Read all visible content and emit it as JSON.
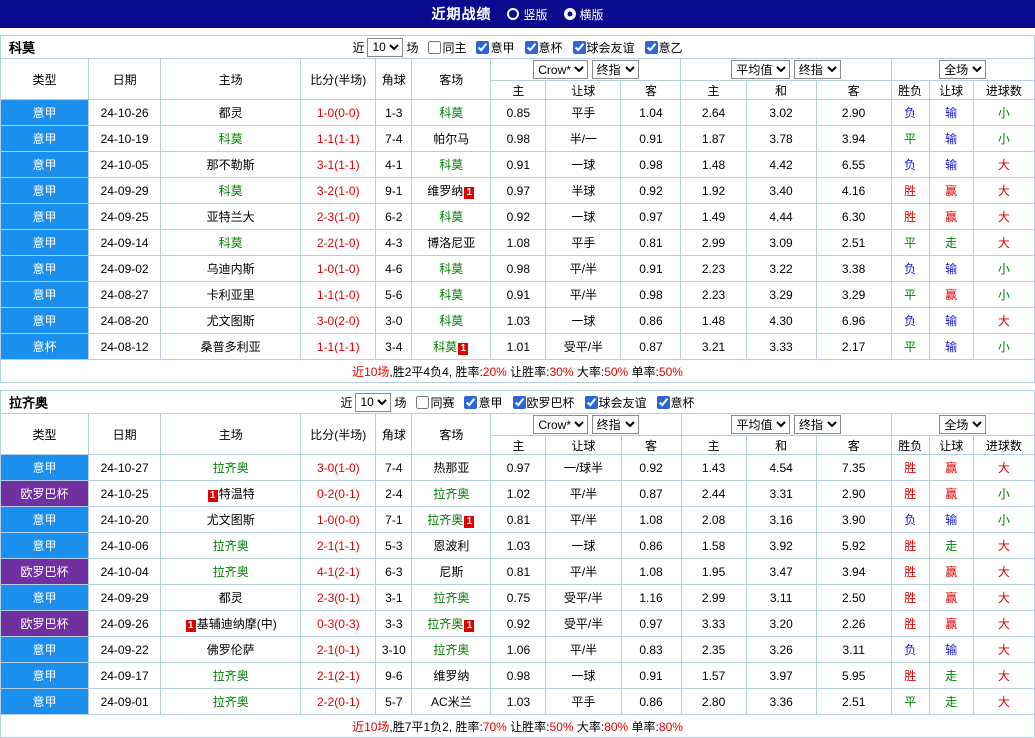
{
  "topbar": {
    "title": "近期战绩",
    "radios": [
      {
        "label": "竖版",
        "checked": false
      },
      {
        "label": "横版",
        "checked": true
      }
    ]
  },
  "colors": {
    "topbar_navy": "#0a0a8e",
    "league_blue": "#1a8fee",
    "league_purple": "#7030a0",
    "win_red": "#e10000",
    "draw_green": "#008000",
    "lose_blue": "#1515d8",
    "grid_line": "#b6cde5"
  },
  "ui": {
    "near": "近",
    "near_value": "10",
    "games": "场"
  },
  "columns": {
    "type": "类型",
    "date": "日期",
    "home": "主场",
    "score": "比分(半场)",
    "corner": "角球",
    "away": "客场",
    "dd_asian": "Crow*",
    "dd_asian_fin": "终指",
    "dd_avg": "平均值",
    "dd_avg_fin": "终指",
    "dd_full": "全场",
    "sub": [
      "主",
      "让球",
      "客",
      "主",
      "和",
      "客",
      "胜负",
      "让球",
      "进球数"
    ]
  },
  "table1": {
    "team": "科莫",
    "filters": [
      {
        "label": "同主",
        "checked": false
      },
      {
        "label": "意甲",
        "checked": true
      },
      {
        "label": "意杯",
        "checked": true
      },
      {
        "label": "球会友谊",
        "checked": true
      },
      {
        "label": "意乙",
        "checked": true
      }
    ],
    "rows": [
      {
        "type": "意甲",
        "type_color": "league-blue",
        "date": "24-10-26",
        "home": "都灵",
        "home_color": "black",
        "score": "1-0(0-0)",
        "corner": "1-3",
        "away": "科莫",
        "away_color": "green",
        "asian": [
          "0.85",
          "平手",
          "1.04"
        ],
        "euro": [
          "2.64",
          "3.02",
          "2.90"
        ],
        "res": [
          "负",
          "输",
          "小"
        ],
        "res_colors": [
          "blue",
          "blue",
          "green"
        ]
      },
      {
        "type": "意甲",
        "type_color": "league-blue",
        "date": "24-10-19",
        "home": "科莫",
        "home_color": "green",
        "score": "1-1(1-1)",
        "corner": "7-4",
        "away": "帕尔马",
        "away_color": "black",
        "asian": [
          "0.98",
          "半/一",
          "0.91"
        ],
        "euro": [
          "1.87",
          "3.78",
          "3.94"
        ],
        "res": [
          "平",
          "输",
          "小"
        ],
        "res_colors": [
          "green",
          "blue",
          "green"
        ]
      },
      {
        "type": "意甲",
        "type_color": "league-blue",
        "date": "24-10-05",
        "home": "那不勒斯",
        "home_color": "black",
        "score": "3-1(1-1)",
        "corner": "4-1",
        "away": "科莫",
        "away_color": "green",
        "asian": [
          "0.91",
          "一球",
          "0.98"
        ],
        "euro": [
          "1.48",
          "4.42",
          "6.55"
        ],
        "res": [
          "负",
          "输",
          "大"
        ],
        "res_colors": [
          "blue",
          "blue",
          "red"
        ]
      },
      {
        "type": "意甲",
        "type_color": "league-blue",
        "date": "24-09-29",
        "home": "科莫",
        "home_color": "green",
        "score": "3-2(1-0)",
        "corner": "9-1",
        "away": "维罗纳",
        "away_color": "black",
        "away_badge_post": "1",
        "asian": [
          "0.97",
          "半球",
          "0.92"
        ],
        "euro": [
          "1.92",
          "3.40",
          "4.16"
        ],
        "res": [
          "胜",
          "赢",
          "大"
        ],
        "res_colors": [
          "red",
          "red",
          "red"
        ]
      },
      {
        "type": "意甲",
        "type_color": "league-blue",
        "date": "24-09-25",
        "home": "亚特兰大",
        "home_color": "black",
        "score": "2-3(1-0)",
        "corner": "6-2",
        "away": "科莫",
        "away_color": "green",
        "asian": [
          "0.92",
          "一球",
          "0.97"
        ],
        "euro": [
          "1.49",
          "4.44",
          "6.30"
        ],
        "res": [
          "胜",
          "赢",
          "大"
        ],
        "res_colors": [
          "red",
          "red",
          "red"
        ]
      },
      {
        "type": "意甲",
        "type_color": "league-blue",
        "date": "24-09-14",
        "home": "科莫",
        "home_color": "green",
        "score": "2-2(1-0)",
        "corner": "4-3",
        "away": "博洛尼亚",
        "away_color": "black",
        "asian": [
          "1.08",
          "平手",
          "0.81"
        ],
        "euro": [
          "2.99",
          "3.09",
          "2.51"
        ],
        "res": [
          "平",
          "走",
          "大"
        ],
        "res_colors": [
          "green",
          "green",
          "red"
        ]
      },
      {
        "type": "意甲",
        "type_color": "league-blue",
        "date": "24-09-02",
        "home": "乌迪内斯",
        "home_color": "black",
        "score": "1-0(1-0)",
        "corner": "4-6",
        "away": "科莫",
        "away_color": "green",
        "asian": [
          "0.98",
          "平/半",
          "0.91"
        ],
        "euro": [
          "2.23",
          "3.22",
          "3.38"
        ],
        "res": [
          "负",
          "输",
          "小"
        ],
        "res_colors": [
          "blue",
          "blue",
          "green"
        ]
      },
      {
        "type": "意甲",
        "type_color": "league-blue",
        "date": "24-08-27",
        "home": "卡利亚里",
        "home_color": "black",
        "score": "1-1(1-0)",
        "corner": "5-6",
        "away": "科莫",
        "away_color": "green",
        "asian": [
          "0.91",
          "平/半",
          "0.98"
        ],
        "euro": [
          "2.23",
          "3.29",
          "3.29"
        ],
        "res": [
          "平",
          "赢",
          "小"
        ],
        "res_colors": [
          "green",
          "red",
          "green"
        ]
      },
      {
        "type": "意甲",
        "type_color": "league-blue",
        "date": "24-08-20",
        "home": "尤文图斯",
        "home_color": "black",
        "score": "3-0(2-0)",
        "corner": "3-0",
        "away": "科莫",
        "away_color": "green",
        "asian": [
          "1.03",
          "一球",
          "0.86"
        ],
        "euro": [
          "1.48",
          "4.30",
          "6.96"
        ],
        "res": [
          "负",
          "输",
          "大"
        ],
        "res_colors": [
          "blue",
          "blue",
          "red"
        ]
      },
      {
        "type": "意杯",
        "type_color": "league-blue",
        "date": "24-08-12",
        "home": "桑普多利亚",
        "home_color": "black",
        "score": "1-1(1-1)",
        "corner": "3-4",
        "away": "科莫",
        "away_color": "green",
        "away_badge_post": "1",
        "asian": [
          "1.01",
          "受平/半",
          "0.87"
        ],
        "euro": [
          "3.21",
          "3.33",
          "2.17"
        ],
        "res": [
          "平",
          "输",
          "小"
        ],
        "res_colors": [
          "green",
          "blue",
          "green"
        ]
      }
    ],
    "summary": [
      {
        "text": "近10场",
        "color": "red"
      },
      {
        "text": ",胜2平4负4, 胜率:",
        "color": "black"
      },
      {
        "text": "20%",
        "color": "red"
      },
      {
        "text": " 让胜率:",
        "color": "black"
      },
      {
        "text": "30%",
        "color": "red"
      },
      {
        "text": " 大率:",
        "color": "black"
      },
      {
        "text": "50%",
        "color": "red"
      },
      {
        "text": " 单率:",
        "color": "black"
      },
      {
        "text": "50%",
        "color": "red"
      }
    ]
  },
  "table2": {
    "team": "拉齐奥",
    "filters": [
      {
        "label": "同赛",
        "checked": false
      },
      {
        "label": "意甲",
        "checked": true
      },
      {
        "label": "欧罗巴杯",
        "checked": true
      },
      {
        "label": "球会友谊",
        "checked": true
      },
      {
        "label": "意杯",
        "checked": true
      }
    ],
    "rows": [
      {
        "type": "意甲",
        "type_color": "league-blue",
        "date": "24-10-27",
        "home": "拉齐奥",
        "home_color": "green",
        "score": "3-0(1-0)",
        "corner": "7-4",
        "away": "热那亚",
        "away_color": "black",
        "asian": [
          "0.97",
          "一/球半",
          "0.92"
        ],
        "euro": [
          "1.43",
          "4.54",
          "7.35"
        ],
        "res": [
          "胜",
          "赢",
          "大"
        ],
        "res_colors": [
          "red",
          "red",
          "red"
        ]
      },
      {
        "type": "欧罗巴杯",
        "type_color": "league-purple",
        "date": "24-10-25",
        "home": "特温特",
        "home_color": "black",
        "home_badge_pre": "1",
        "score": "0-2(0-1)",
        "corner": "2-4",
        "away": "拉齐奥",
        "away_color": "green",
        "asian": [
          "1.02",
          "平/半",
          "0.87"
        ],
        "euro": [
          "2.44",
          "3.31",
          "2.90"
        ],
        "res": [
          "胜",
          "赢",
          "小"
        ],
        "res_colors": [
          "red",
          "red",
          "green"
        ]
      },
      {
        "type": "意甲",
        "type_color": "league-blue",
        "date": "24-10-20",
        "home": "尤文图斯",
        "home_color": "black",
        "score": "1-0(0-0)",
        "corner": "7-1",
        "away": "拉齐奥",
        "away_color": "green",
        "away_badge_post": "1",
        "asian": [
          "0.81",
          "平/半",
          "1.08"
        ],
        "euro": [
          "2.08",
          "3.16",
          "3.90"
        ],
        "res": [
          "负",
          "输",
          "小"
        ],
        "res_colors": [
          "blue",
          "blue",
          "green"
        ]
      },
      {
        "type": "意甲",
        "type_color": "league-blue",
        "date": "24-10-06",
        "home": "拉齐奥",
        "home_color": "green",
        "score": "2-1(1-1)",
        "corner": "5-3",
        "away": "恩波利",
        "away_color": "black",
        "asian": [
          "1.03",
          "一球",
          "0.86"
        ],
        "euro": [
          "1.58",
          "3.92",
          "5.92"
        ],
        "res": [
          "胜",
          "走",
          "大"
        ],
        "res_colors": [
          "red",
          "green",
          "red"
        ]
      },
      {
        "type": "欧罗巴杯",
        "type_color": "league-purple",
        "date": "24-10-04",
        "home": "拉齐奥",
        "home_color": "green",
        "score": "4-1(2-1)",
        "corner": "6-3",
        "away": "尼斯",
        "away_color": "black",
        "asian": [
          "0.81",
          "平/半",
          "1.08"
        ],
        "euro": [
          "1.95",
          "3.47",
          "3.94"
        ],
        "res": [
          "胜",
          "赢",
          "大"
        ],
        "res_colors": [
          "red",
          "red",
          "red"
        ]
      },
      {
        "type": "意甲",
        "type_color": "league-blue",
        "date": "24-09-29",
        "home": "都灵",
        "home_color": "black",
        "score": "2-3(0-1)",
        "corner": "3-1",
        "away": "拉齐奥",
        "away_color": "green",
        "asian": [
          "0.75",
          "受平/半",
          "1.16"
        ],
        "euro": [
          "2.99",
          "3.11",
          "2.50"
        ],
        "res": [
          "胜",
          "赢",
          "大"
        ],
        "res_colors": [
          "red",
          "red",
          "red"
        ]
      },
      {
        "type": "欧罗巴杯",
        "type_color": "league-purple",
        "date": "24-09-26",
        "home": "基辅迪纳摩(中)",
        "home_color": "black",
        "home_badge_pre": "1",
        "score": "0-3(0-3)",
        "corner": "3-3",
        "away": "拉齐奥",
        "away_color": "green",
        "away_badge_post": "1",
        "asian": [
          "0.92",
          "受平/半",
          "0.97"
        ],
        "euro": [
          "3.33",
          "3.20",
          "2.26"
        ],
        "res": [
          "胜",
          "赢",
          "大"
        ],
        "res_colors": [
          "red",
          "red",
          "red"
        ]
      },
      {
        "type": "意甲",
        "type_color": "league-blue",
        "date": "24-09-22",
        "home": "佛罗伦萨",
        "home_color": "black",
        "score": "2-1(0-1)",
        "corner": "3-10",
        "away": "拉齐奥",
        "away_color": "green",
        "asian": [
          "1.06",
          "平/半",
          "0.83"
        ],
        "euro": [
          "2.35",
          "3.26",
          "3.11"
        ],
        "res": [
          "负",
          "输",
          "大"
        ],
        "res_colors": [
          "blue",
          "blue",
          "red"
        ]
      },
      {
        "type": "意甲",
        "type_color": "league-blue",
        "date": "24-09-17",
        "home": "拉齐奥",
        "home_color": "green",
        "score": "2-1(2-1)",
        "corner": "9-6",
        "away": "维罗纳",
        "away_color": "black",
        "asian": [
          "0.98",
          "一球",
          "0.91"
        ],
        "euro": [
          "1.57",
          "3.97",
          "5.95"
        ],
        "res": [
          "胜",
          "走",
          "大"
        ],
        "res_colors": [
          "red",
          "green",
          "red"
        ]
      },
      {
        "type": "意甲",
        "type_color": "league-blue",
        "date": "24-09-01",
        "home": "拉齐奥",
        "home_color": "green",
        "score": "2-2(0-1)",
        "corner": "5-7",
        "away": "AC米兰",
        "away_color": "black",
        "asian": [
          "1.03",
          "平手",
          "0.86"
        ],
        "euro": [
          "2.80",
          "3.36",
          "2.51"
        ],
        "res": [
          "平",
          "走",
          "大"
        ],
        "res_colors": [
          "green",
          "green",
          "red"
        ]
      }
    ],
    "summary": [
      {
        "text": "近10场",
        "color": "red"
      },
      {
        "text": ",胜7平1负2, 胜率:",
        "color": "black"
      },
      {
        "text": "70%",
        "color": "red"
      },
      {
        "text": " 让胜率:",
        "color": "black"
      },
      {
        "text": "50%",
        "color": "red"
      },
      {
        "text": " 大率:",
        "color": "black"
      },
      {
        "text": "80%",
        "color": "red"
      },
      {
        "text": " 单率:",
        "color": "black"
      },
      {
        "text": "80%",
        "color": "red"
      }
    ]
  }
}
